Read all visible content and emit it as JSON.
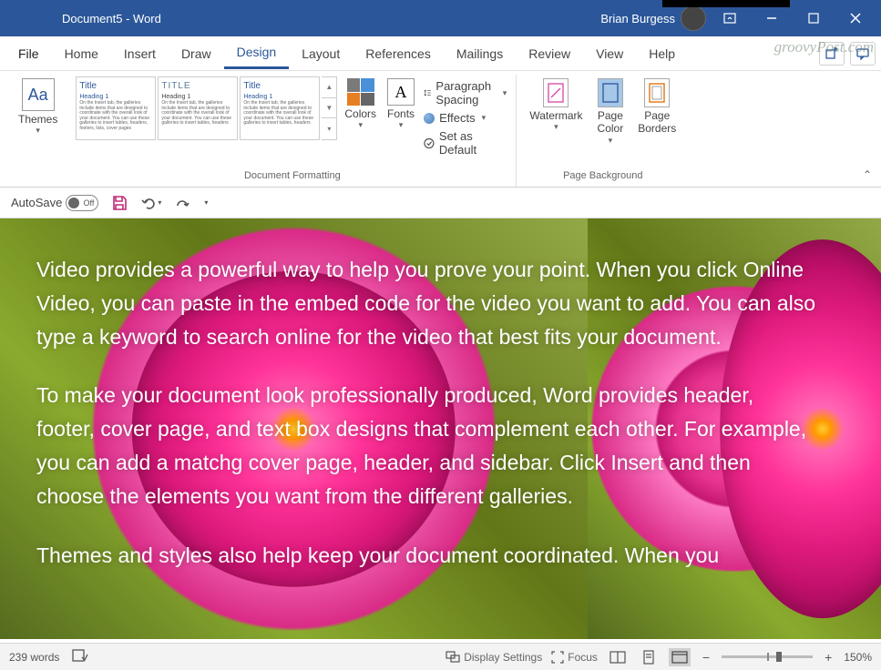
{
  "titlebar": {
    "title": "Document5  -  Word",
    "user": "Brian Burgess"
  },
  "menu": {
    "tabs": [
      "File",
      "Home",
      "Insert",
      "Draw",
      "Design",
      "Layout",
      "References",
      "Mailings",
      "Review",
      "View",
      "Help"
    ],
    "active_index": 4
  },
  "ribbon": {
    "themes_label": "Themes",
    "gallery": [
      {
        "title": "Title",
        "heading": "Heading 1",
        "body": "On the Insert tab, the galleries include items that are designed to coordinate with the overall look of your document. You can use these galleries to insert tables, headers, footers, lists, cover pages"
      },
      {
        "title": "TITLE",
        "heading": "Heading 1",
        "body": "On the Insert tab, the galleries include items that are designed to coordinate with the overall look of your document. You can use these galleries to insert tables, headers"
      },
      {
        "title": "Title",
        "heading": "Heading 1",
        "body": "On the Insert tab, the galleries include items that are designed to coordinate with the overall look of your document. You can use these galleries to insert tables, headers"
      }
    ],
    "colors_label": "Colors",
    "fonts_label": "Fonts",
    "paragraph_spacing": "Paragraph Spacing",
    "effects": "Effects",
    "set_default": "Set as Default",
    "watermark_label": "Watermark",
    "page_color_label": "Page\nColor",
    "page_borders_label": "Page\nBorders",
    "group_doc_fmt": "Document Formatting",
    "group_page_bg": "Page Background"
  },
  "qat": {
    "autosave_label": "AutoSave",
    "autosave_state": "Off"
  },
  "document": {
    "p1": "Video provides a powerful way to help you prove your point. When you click Online Video, you can paste in the embed code for the video you want to add. You can also type a keyword to search online for the video that best fits your document.",
    "p2": "To make your document look professionally produced, Word provides header, footer, cover page, and text box designs that complement each other. For example, you can add a matchg cover page, header, and sidebar. Click Insert and then choose the elements you want from the different galleries.",
    "p3": "Themes and styles also help keep your document coordinated. When you"
  },
  "status": {
    "words": "239 words",
    "display_settings": "Display Settings",
    "focus": "Focus",
    "zoom": "150%"
  },
  "watermark_text": "groovyPost.com"
}
